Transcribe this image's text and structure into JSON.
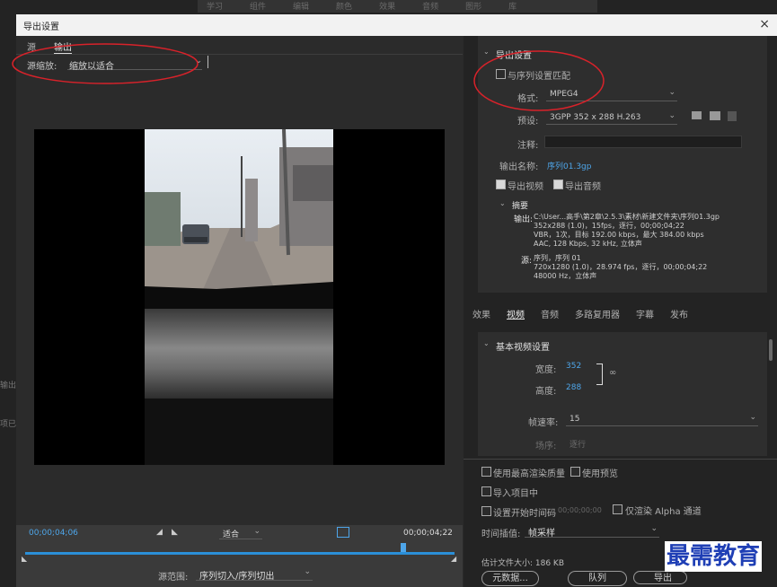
{
  "top_menu": [
    "学习",
    "组件",
    "编辑",
    "颜色",
    "效果",
    "音频",
    "图形",
    "库"
  ],
  "bg_fragments": {
    "a": "输出",
    "b": "项已导"
  },
  "dialog": {
    "title": "导出设置",
    "close": "×"
  },
  "left": {
    "tabs": [
      "源",
      "输出"
    ],
    "source_scale_label": "源缩放:",
    "source_scale_value": "缩放以适合",
    "timecode_start": "00;00;04;06",
    "timecode_end": "00;00;04;22",
    "fit_value": "适合",
    "range_label": "源范围:",
    "range_value": "序列切入/序列切出"
  },
  "export": {
    "header": "导出设置",
    "match_sequence": "与序列设置匹配",
    "format_label": "格式:",
    "format_value": "MPEG4",
    "preset_label": "预设:",
    "preset_value": "3GPP 352 x 288 H.263",
    "comment_label": "注释:",
    "output_name_label": "输出名称:",
    "output_name_value": "序列01.3gp",
    "export_video": "导出视频",
    "export_audio": "导出音频"
  },
  "summary": {
    "header": "摘要",
    "output_label": "输出:",
    "output_lines": [
      "C:\\User...高手\\第2章\\2.5.3\\素材\\新建文件夹\\序列01.3gp",
      "352x288 (1.0)，15fps，逐行，00;00;04;22",
      "VBR，1次，目标 192.00 kbps，最大 384.00 kbps",
      "AAC, 128 Kbps, 32 kHz, 立体声"
    ],
    "source_label": "源:",
    "source_lines": [
      "序列，序列 01",
      "720x1280 (1.0)，28.974 fps，逐行，00;00;04;22",
      "48000 Hz，立体声"
    ]
  },
  "tabs": [
    "效果",
    "视频",
    "音频",
    "多路复用器",
    "字幕",
    "发布"
  ],
  "video": {
    "header": "基本视频设置",
    "width_label": "宽度:",
    "width_value": "352",
    "height_label": "高度:",
    "height_value": "288",
    "fps_label": "帧速率:",
    "fps_value": "15",
    "field_label": "场序:",
    "field_value": "逐行"
  },
  "bottom": {
    "max_quality": "使用最高渲染质量",
    "use_previews": "使用预览",
    "import_project": "导入项目中",
    "set_start_tc": "设置开始时间码",
    "start_tc_value": "00;00;00;00",
    "render_alpha": "仅渲染 Alpha 通道",
    "time_interp_label": "时间插值:",
    "time_interp_value": "帧采样",
    "file_size": "估计文件大小: 186 KB",
    "metadata_btn": "元数据...",
    "queue_btn": "队列",
    "export_btn": "导出"
  },
  "watermark": "最需教育"
}
